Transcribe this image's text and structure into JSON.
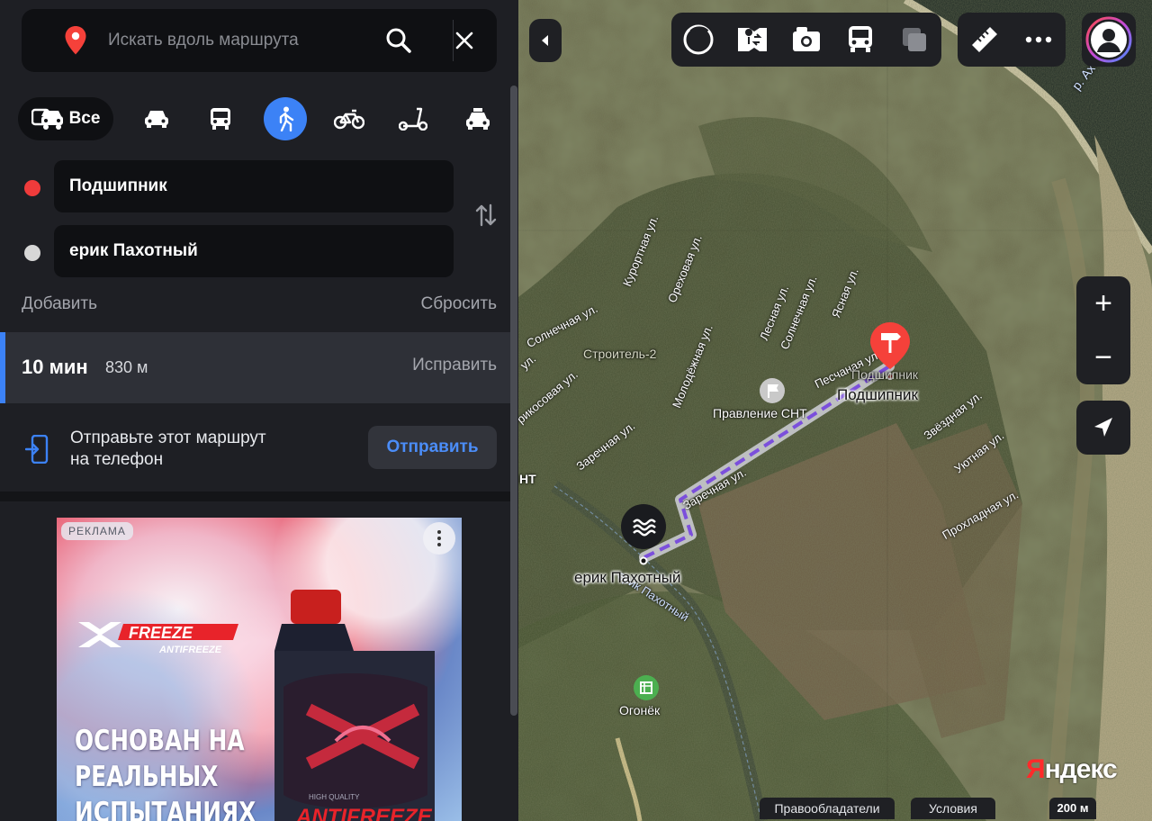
{
  "search": {
    "placeholder": "Искать вдоль маршрута"
  },
  "modes": {
    "all_label": "Все",
    "active": "walk"
  },
  "points": {
    "from": "Подшипник",
    "to": "ерик Пахотный",
    "from_color": "#ef3b3b",
    "to_color": "#d7d7d7"
  },
  "actions": {
    "add": "Добавить",
    "reset": "Сбросить"
  },
  "route": {
    "time": "10 мин",
    "distance": "830 м",
    "fix": "Исправить"
  },
  "send": {
    "line1": "Отправьте этот маршрут",
    "line2": "на телефон",
    "button": "Отправить"
  },
  "ad": {
    "badge": "РЕКЛАМА",
    "brand": "FREEZE",
    "brand_sub": "ANTIFREEZE",
    "slogan": "ОСНОВАН НА РЕАЛЬНЫХ ИСПЫТАНИЯХ",
    "bottle_label": "ANTIFREEZE",
    "bottle_small": "HIGH QUALITY"
  },
  "map": {
    "river": "р. Ахтуба",
    "area": "Строитель-2",
    "place_from": "Подшипник",
    "place_from_small": "Подшипник",
    "place_to": "ерик Пахотный",
    "creek": "ерик Пахотный",
    "poi_board": "Правление СНТ",
    "poi_ogonek": "Огонёк",
    "snt_cut": "НТ",
    "streets": {
      "kurortnaya": "Курортная ул.",
      "orehovaya": "Ореховая ул.",
      "lesnaya": "Лесная ул.",
      "solnechnaya1": "Солнечная ул.",
      "yasnaya": "Ясная ул.",
      "solnechnaya2": "Солнечная ул.",
      "molodezhnaya": "Молодёжная ул.",
      "peschanaya": "Песчаная ул.",
      "zarechnaya1": "Заречная ул.",
      "zarechnaya2": "Заречная ул.",
      "abrikosovaya": "рикосовая ул.",
      "u_cut": "ул.",
      "zvezdnaya": "Звёздная ул.",
      "uyutnaya": "Уютная ул.",
      "prohladnaya": "Прохладная ул."
    },
    "route_color": "#7b4fdc",
    "pin_color": "#f5413a",
    "zoom_in": "+",
    "zoom_out": "−",
    "rights": "Правообладатели",
    "terms": "Условия",
    "scale": "200 м",
    "brand_y": "Я",
    "brand_rest": "ндекс"
  }
}
